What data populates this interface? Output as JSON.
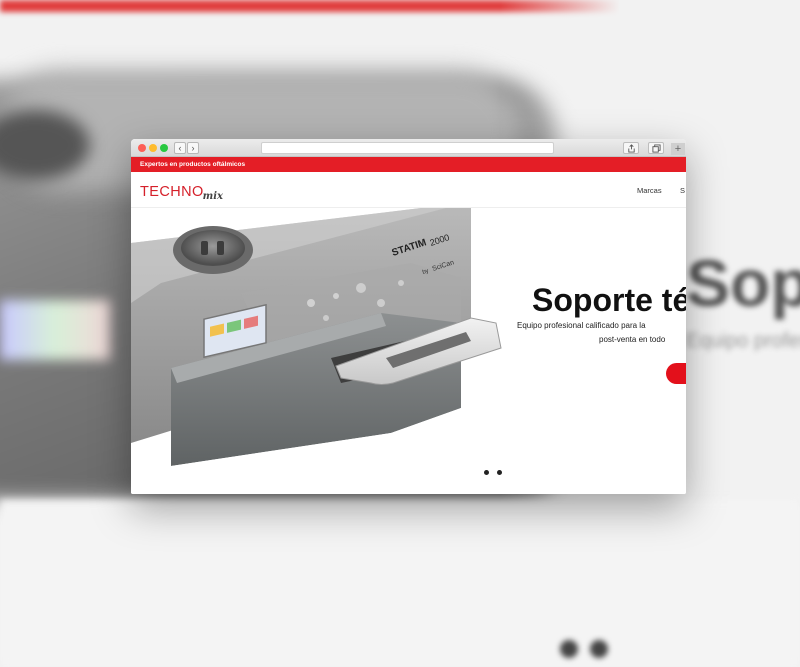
{
  "site": {
    "top_strip_text": "Expertos en productos oftálmicos",
    "logo": {
      "main": "TECHNO",
      "script": "mix"
    },
    "nav": {
      "marcas": "Marcas",
      "s": "S"
    }
  },
  "hero": {
    "title": "Soporte té",
    "subtitle_line1": "Equipo profesional calificado para la",
    "subtitle_line2": "post-venta en todo",
    "product_label_brand": "STATIM",
    "product_label_model": "2000",
    "product_label_by": "by",
    "product_label_maker": "SciCan",
    "slide_count": 2
  },
  "backdrop": {
    "title": "Sopo",
    "subtitle": "Equipo profesio"
  },
  "colors": {
    "brand_red": "#e41e26",
    "logo_red": "#d5202a",
    "cta_red": "#e3101b"
  }
}
